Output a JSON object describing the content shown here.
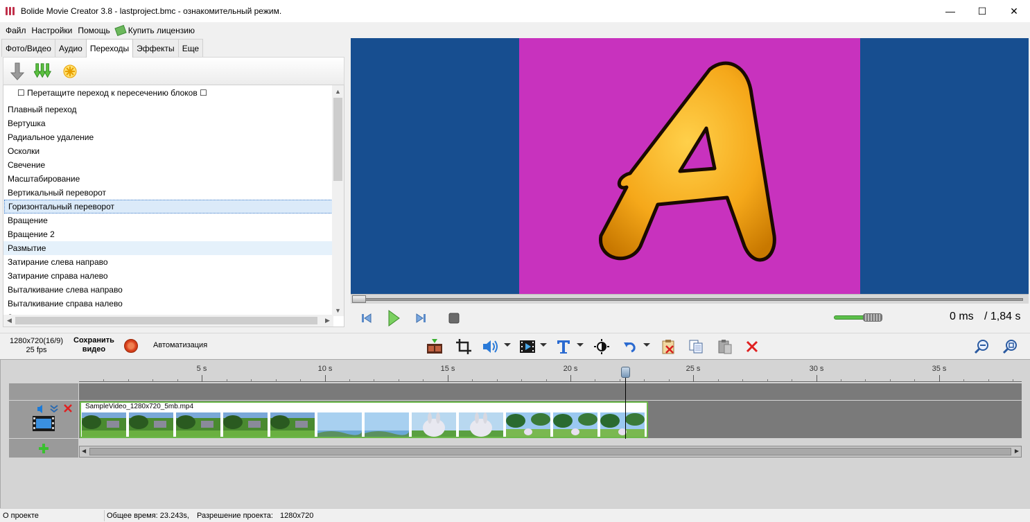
{
  "window": {
    "title": "Bolide Movie Creator 3.8 - lastproject.bmc  - ознакомительный режим.",
    "minimize": "—",
    "maximize": "☐",
    "close": "✕"
  },
  "menu": {
    "file": "Файл",
    "settings": "Настройки",
    "help": "Помощь",
    "buy": "Купить лицензию"
  },
  "tabs": [
    {
      "label": "Фото/Видео"
    },
    {
      "label": "Аудио"
    },
    {
      "label": "Переходы",
      "active": true
    },
    {
      "label": "Эффекты"
    },
    {
      "label": "Еще"
    }
  ],
  "transitions": {
    "hint": "☐ Перетащите переход к пересечению блоков ☐",
    "items": [
      "Плавный переход",
      "Вертушка",
      "Радиальное удаление",
      "Осколки",
      "Свечение",
      "Масштабирование",
      "Вертикальный переворот",
      "Горизонтальный переворот",
      "Вращение",
      "Вращение 2",
      "Размытие",
      "Затирание слева направо",
      "Затирание справа налево",
      "Выталкивание слева направо",
      "Выталкивание справа налево",
      "Затирание сверху вниз"
    ],
    "selected_index": 7,
    "hover_index": 10
  },
  "preview": {
    "background_color": "#174e90",
    "canvas_color": "#c832be",
    "letter": "A",
    "letter_color": "#f5a81a"
  },
  "player": {
    "time_current": "0 ms",
    "time_total": "/ 1,84 s",
    "volume_level": 0.75,
    "seek_position": 0
  },
  "toolbar": {
    "resolution": "1280x720(16/9)",
    "fps": "25 fps",
    "save_line1": "Сохранить",
    "save_line2": "видео",
    "automation": "Автоматизация"
  },
  "timeline": {
    "ticks": [
      "5 s",
      "10 s",
      "15 s",
      "20 s",
      "25 s",
      "30 s",
      "35 s"
    ],
    "clip_title": "SampleVideo_1280x720_5mb.mp4",
    "playhead_time_s": 22.1,
    "clip_end_s": 23.2
  },
  "status": {
    "about": "О проекте",
    "total_time": "Общее время: 23.243s,",
    "resolution_label": "Разрешение проекта:",
    "resolution_value": "1280x720"
  }
}
